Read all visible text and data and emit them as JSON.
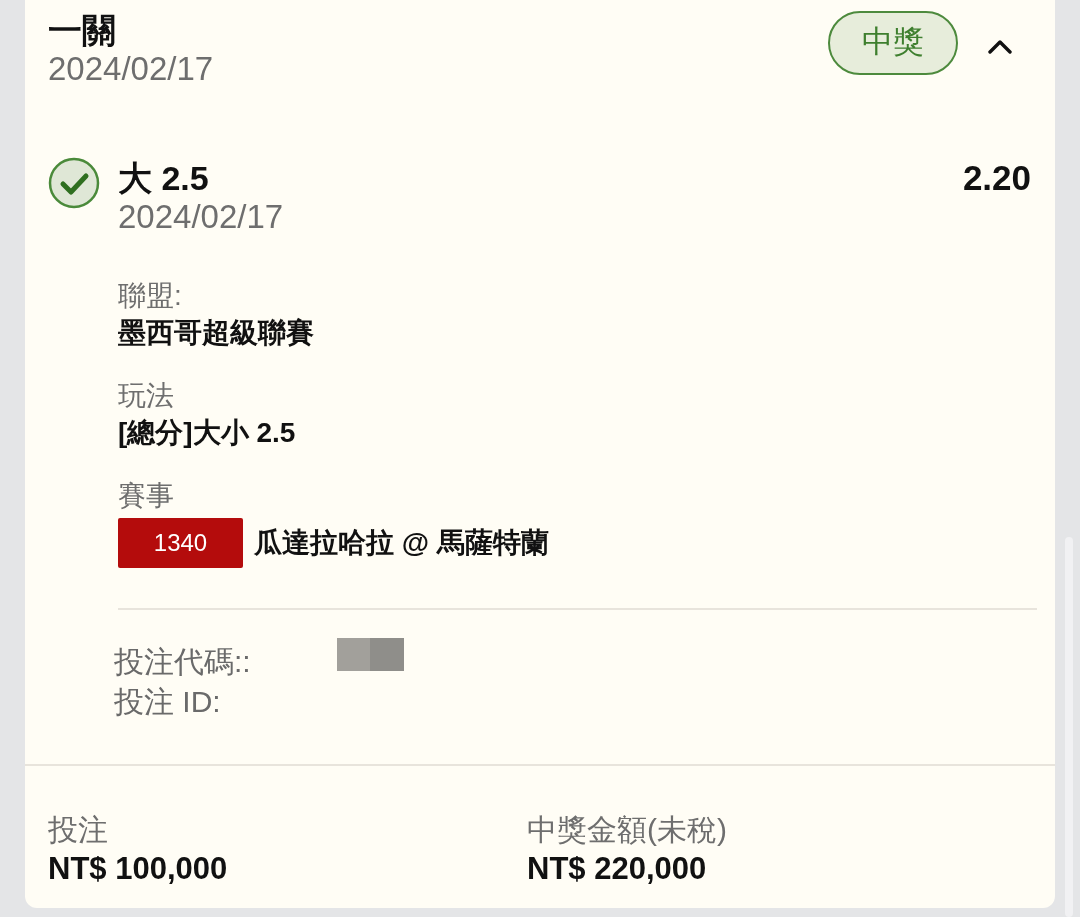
{
  "ticket": {
    "title": "一關",
    "date": "2024/02/17",
    "badge": {
      "label": "中獎",
      "won": true
    },
    "expanded": true
  },
  "selections": [
    {
      "won": true,
      "pick": "大 2.5",
      "date": "2024/02/17",
      "odds": "2.20",
      "details": [
        {
          "kind": "text",
          "label": "聯盟:",
          "value": "墨西哥超級聯賽"
        },
        {
          "kind": "text",
          "label": "玩法",
          "value": "[總分]大小 2.5"
        },
        {
          "kind": "match",
          "label": "賽事",
          "code": "1340",
          "value": "瓜達拉哈拉 @ 馬薩特蘭"
        }
      ]
    }
  ],
  "bet_info": {
    "code_label": "投注代碼::",
    "id_label": "投注 ID:",
    "redacted": true
  },
  "summary": [
    {
      "label": "投注",
      "amount": "NT$ 100,000"
    },
    {
      "label": "中獎金額(未稅)",
      "amount": "NT$ 220,000"
    }
  ]
}
